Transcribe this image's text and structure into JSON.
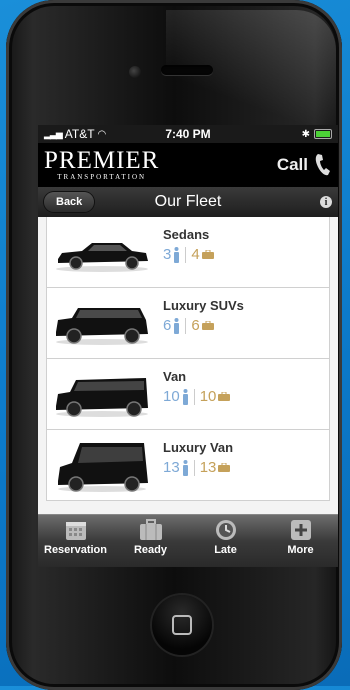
{
  "status": {
    "carrier": "AT&T",
    "time": "7:40 PM"
  },
  "brand": {
    "name": "PREMIER",
    "tagline": "TRANSPORTATION",
    "call_label": "Call"
  },
  "nav": {
    "back_label": "Back",
    "title": "Our Fleet",
    "info_icon": "info-icon"
  },
  "fleet": [
    {
      "name": "Sedans",
      "passengers": "3",
      "bags": "4"
    },
    {
      "name": "Luxury SUVs",
      "passengers": "6",
      "bags": "6"
    },
    {
      "name": "Van",
      "passengers": "10",
      "bags": "10"
    },
    {
      "name": "Luxury Van",
      "passengers": "13",
      "bags": "13"
    }
  ],
  "tabs": [
    {
      "label": "Reservation",
      "icon": "calendar-icon"
    },
    {
      "label": "Ready",
      "icon": "briefcase-icon"
    },
    {
      "label": "Late",
      "icon": "clock-icon"
    },
    {
      "label": "More",
      "icon": "plus-icon"
    }
  ],
  "colors": {
    "passenger": "#7ea9d6",
    "bag": "#c5a15a",
    "background": "#0b78c8"
  }
}
